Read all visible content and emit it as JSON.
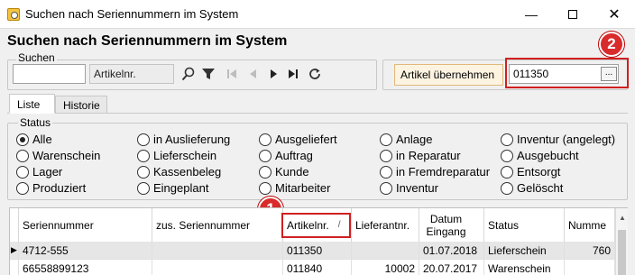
{
  "window": {
    "title": "Suchen nach Seriennummern im System"
  },
  "page_title": "Suchen nach Seriennummern im System",
  "search": {
    "legend": "Suchen",
    "input_value": "",
    "field_combo": "Artikelnr."
  },
  "article": {
    "button_label": "Artikel übernehmen",
    "value": "011350",
    "ellipsis": "..."
  },
  "markers": [
    "1",
    "2"
  ],
  "tabs": [
    {
      "label": "Liste",
      "active": true
    },
    {
      "label": "Historie",
      "active": false
    }
  ],
  "status": {
    "legend": "Status",
    "options": [
      {
        "label": "Alle",
        "checked": true
      },
      {
        "label": "Warenschein",
        "checked": false
      },
      {
        "label": "Lager",
        "checked": false
      },
      {
        "label": "Produziert",
        "checked": false
      },
      {
        "label": "in Auslieferung",
        "checked": false
      },
      {
        "label": "Lieferschein",
        "checked": false
      },
      {
        "label": "Kassenbeleg",
        "checked": false
      },
      {
        "label": "Eingeplant",
        "checked": false
      },
      {
        "label": "Ausgeliefert",
        "checked": false
      },
      {
        "label": "Auftrag",
        "checked": false
      },
      {
        "label": "Kunde",
        "checked": false
      },
      {
        "label": "Mitarbeiter",
        "checked": false
      },
      {
        "label": "Anlage",
        "checked": false
      },
      {
        "label": "in Reparatur",
        "checked": false
      },
      {
        "label": "in Fremdreparatur",
        "checked": false
      },
      {
        "label": "Inventur",
        "checked": false
      },
      {
        "label": "Inventur (angelegt)",
        "checked": false
      },
      {
        "label": "Ausgebucht",
        "checked": false
      },
      {
        "label": "Entsorgt",
        "checked": false
      },
      {
        "label": "Gelöscht",
        "checked": false
      }
    ]
  },
  "grid": {
    "columns": [
      "Seriennummer",
      "zus. Seriennummer",
      "Artikelnr.",
      "Lieferantnr.",
      "Datum Eingang",
      "Status",
      "Numme"
    ],
    "sort_indicator": "/",
    "rows": [
      [
        "4712-555",
        "",
        "011350",
        "",
        "01.07.2018",
        "Lieferschein",
        "760"
      ],
      [
        "66558899123",
        "",
        "011840",
        "10002",
        "20.07.2017",
        "Warenschein",
        ""
      ]
    ],
    "row_pointer": "▶"
  },
  "colors": {
    "marker": "#d92b2b",
    "accent_button_bg": "#fdf3e1"
  }
}
